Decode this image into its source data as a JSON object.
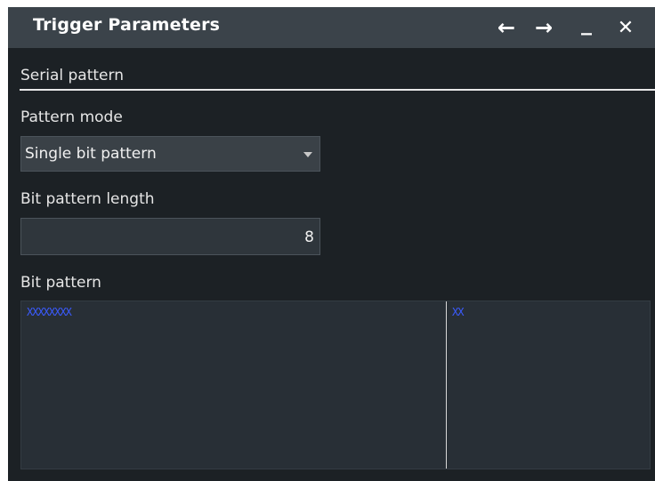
{
  "window": {
    "title": "Trigger Parameters",
    "buttons": {
      "back": "←",
      "forward": "→",
      "minimize": "_",
      "close": "✕"
    }
  },
  "section_title": "Serial pattern",
  "pattern_mode": {
    "label": "Pattern mode",
    "value": "Single bit pattern"
  },
  "bit_pattern_length": {
    "label": "Bit pattern length",
    "value": "8"
  },
  "bit_pattern": {
    "label": "Bit pattern",
    "binary": "XXXXXXXX",
    "hex": "XX"
  },
  "colors": {
    "panel_background": "#1c2125",
    "titlebar": "#3b434a",
    "pattern_text": "#3b5bff"
  }
}
